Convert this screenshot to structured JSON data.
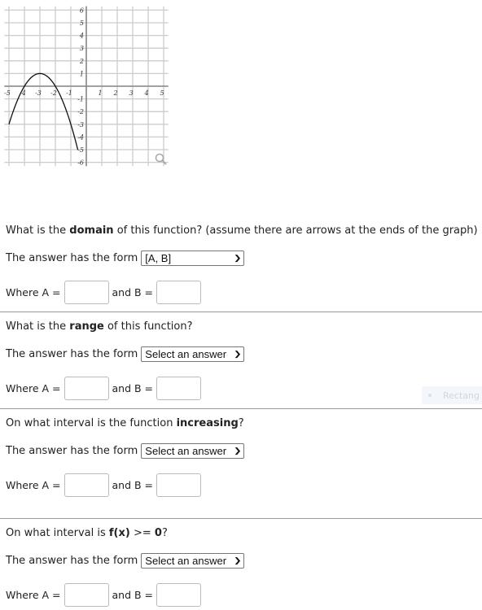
{
  "graph": {
    "x_ticks": [
      "-5",
      "-4",
      "-3",
      "-2",
      "-1",
      "1",
      "2",
      "3",
      "4",
      "5"
    ],
    "y_ticks_pos": [
      "1",
      "2",
      "3",
      "4",
      "5",
      "6"
    ],
    "y_ticks_neg": [
      "-1",
      "-2",
      "-3",
      "-4",
      "-5",
      "-6"
    ],
    "function": {
      "type": "parabola",
      "vertex": [
        -3,
        1
      ],
      "a": -1,
      "x_start": -5,
      "x_end": -0.55
    },
    "zoom_icon": "magnifier-icon"
  },
  "questions": [
    {
      "prefix": "What is the ",
      "bold": "domain",
      "suffix": " of this function? (assume there are arrows at the ends of the graph)",
      "form_label": "The answer has the form",
      "form_value": "[A, B]",
      "a_label": "Where A =",
      "b_label": "and B ="
    },
    {
      "prefix": "What is the ",
      "bold": "range",
      "suffix": " of this function?",
      "form_label": "The answer has the form",
      "form_value": "Select an answer",
      "a_label": "Where A =",
      "b_label": "and B ="
    },
    {
      "prefix": "On what interval is the function ",
      "bold": "increasing",
      "suffix": "?",
      "form_label": "The answer has the form",
      "form_value": "Select an answer",
      "a_label": "Where A =",
      "b_label": "and B ="
    },
    {
      "prefix": "On what interval is ",
      "bold": "f(x)",
      "mid": " >= ",
      "bold2": "0",
      "suffix": "?",
      "form_label": "The answer has the form",
      "form_value": "Select an answer",
      "a_label": "Where A =",
      "b_label": "and B ="
    }
  ],
  "ghost_label": "Rectang"
}
